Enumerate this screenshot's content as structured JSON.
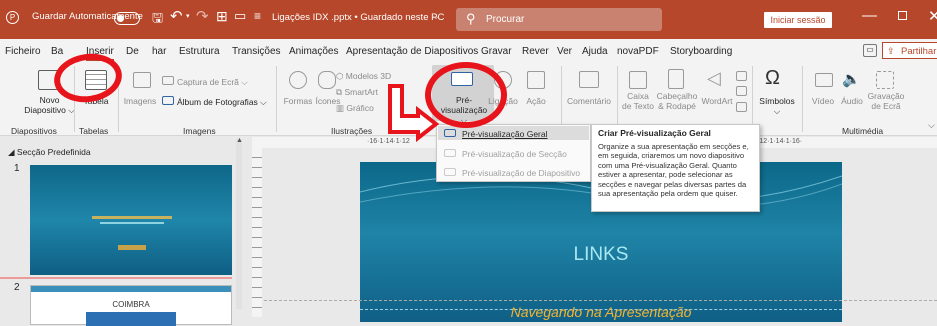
{
  "titlebar": {
    "autosave_label": "Guardar Automaticamente",
    "file_title": "Ligações IDX .pptx • Guardado neste PC",
    "search_placeholder": "Procurar",
    "sign_in": "Iniciar sessão"
  },
  "menu": {
    "items": [
      "Ficheiro",
      "Base",
      "Inserir",
      "Desenhar",
      "Estrutura",
      "Transições",
      "Animações",
      "Apresentação de Diapositivos",
      "Gravar",
      "Rever",
      "Ver",
      "Ajuda",
      "novaPDF",
      "Storyboarding"
    ],
    "visible": [
      "Ficheiro",
      "Ba",
      "Inserir",
      "De",
      "har",
      "Estrutura",
      "Transições",
      "Animações",
      "Apresentação de Diapositivos",
      "Gravar",
      "Rever",
      "Ver",
      "Ajuda",
      "novaPDF",
      "Storyboarding"
    ],
    "share": "Partilhar"
  },
  "ribbon": {
    "new_slide": [
      "Novo",
      "Diapositivo"
    ],
    "table": "Tabela",
    "images": "Imagens",
    "screenshot": "Captura de Ecrã",
    "photo_album": "Álbum de Fotografias",
    "shapes": "Formas",
    "icons": "Ícones",
    "models_3d": "Modelos 3D",
    "smartart": "SmartArt",
    "chart": "Gráfico",
    "zoom": [
      "Pré-",
      "visualização"
    ],
    "link": "Ligação",
    "action": "Ação",
    "comment": "Comentário",
    "textbox": [
      "Caixa",
      "de Texto"
    ],
    "header_footer": [
      "Cabeçalho",
      "& Rodapé"
    ],
    "wordart": "WordArt",
    "symbols": "Símbolos",
    "video": "Vídeo",
    "audio": "Áudio",
    "screen_rec": [
      "Gravação",
      "de Ecrã"
    ],
    "groups": {
      "slides": "Diapositivos",
      "tables": "Tabelas",
      "images": "Imagens",
      "illustrations": "Ilustrações",
      "multimedia": "Multimédia"
    }
  },
  "dropdown": {
    "items": [
      "Pré-visualização Geral",
      "Pré-visualização de Secção",
      "Pré-visualização de Diapositivo"
    ]
  },
  "tooltip": {
    "title": "Criar Pré-visualização Geral",
    "body": "Organize a sua apresentação em secções e, em seguida, criaremos um novo diapositivo com uma Pré-visualização Geral. Quanto estiver a apresentar, pode selecionar as secções e navegar pelas diversas partes da sua apresentação pela ordem que quiser."
  },
  "panel": {
    "section": "Secção Predefinida",
    "slide1_number": "1",
    "slide2_number": "2",
    "slide2_title": "COIMBRA"
  },
  "ruler": {
    "h_left": "·16·1·14·1·12",
    "h_right": "·12·1·14·1·16·"
  },
  "slide": {
    "title": "LINKS",
    "subtitle": "Navegando na Apresentação"
  },
  "colors": {
    "accent": "#b7472a",
    "annotation": "#e8141b",
    "slide_text": "#a8e8f0",
    "subtitle": "#f2b431"
  }
}
